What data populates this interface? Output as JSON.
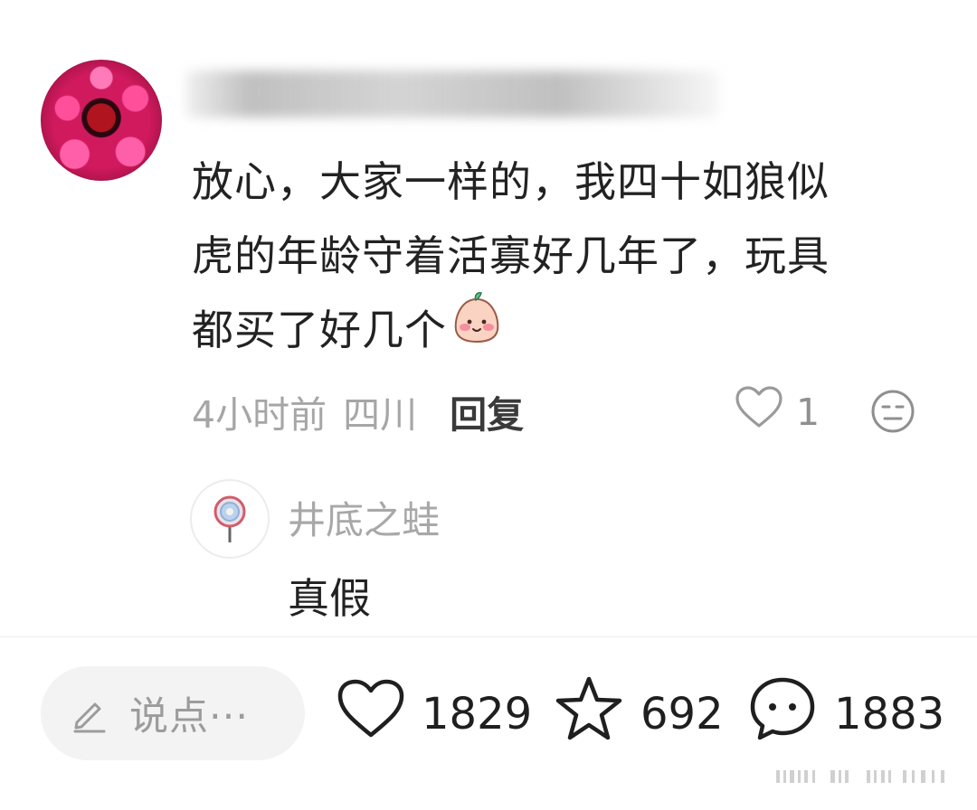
{
  "comment": {
    "text_line1": "放心，大家一样的，我四十如狼似",
    "text_line2": "虎的年龄守着活寡好几年了，玩具",
    "text_line3": "都买了好几个",
    "emoji": "peach-smile-emoji",
    "time": "4小时前",
    "location": "四川",
    "reply_label": "回复",
    "like_count": "1"
  },
  "reply": {
    "author": "井底之蛙",
    "text": "真假"
  },
  "bottom_bar": {
    "input_placeholder": "说点···",
    "likes": "1829",
    "favorites": "692",
    "comments": "1883"
  },
  "colors": {
    "text_primary": "#222222",
    "text_secondary": "#a6a6a6",
    "input_bg": "#f3f3f3"
  }
}
